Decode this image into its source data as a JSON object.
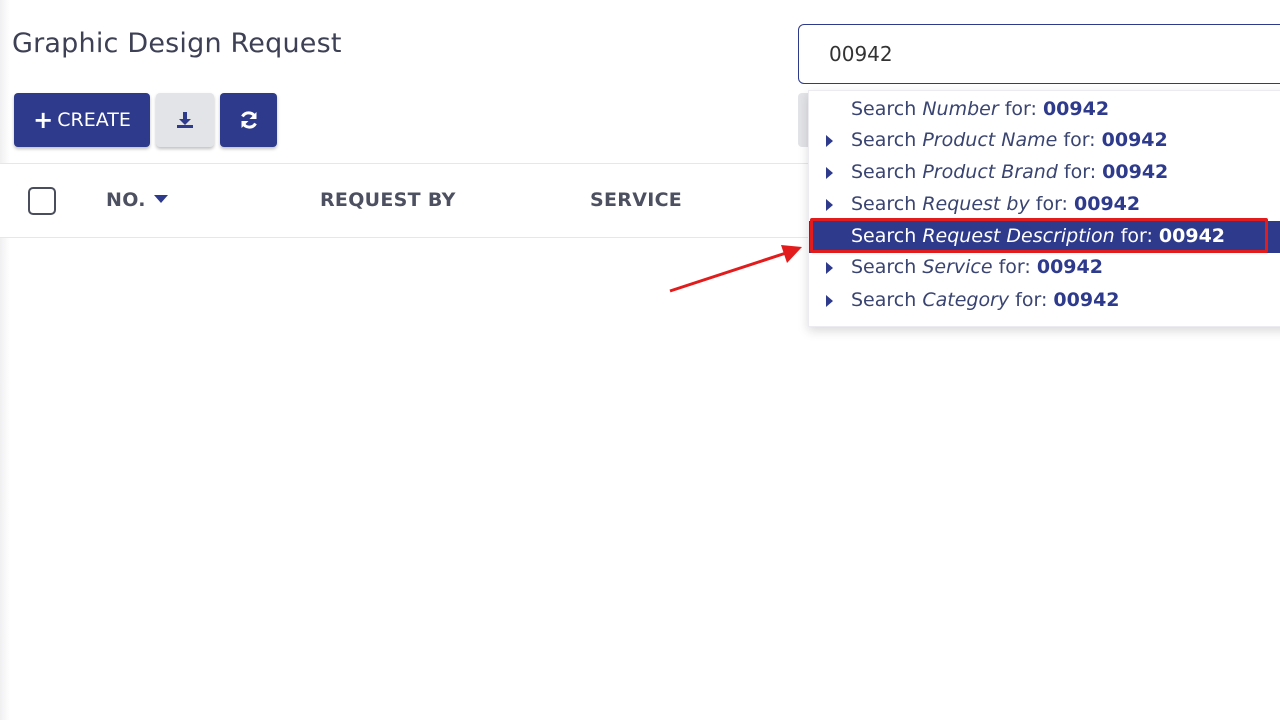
{
  "page": {
    "title": "Graphic Design Request"
  },
  "toolbar": {
    "create_label": "CREATE",
    "create_icon": "plus-icon",
    "download_icon": "download-icon",
    "refresh_icon": "refresh-icon"
  },
  "table": {
    "columns": [
      "NO.",
      "REQUEST BY",
      "SERVICE"
    ],
    "sort_column": "NO."
  },
  "search": {
    "value": "00942",
    "suggestions": [
      {
        "prefix": "Search",
        "field": "Number",
        "mid": "for:",
        "term": "00942",
        "expandable": false,
        "active": false
      },
      {
        "prefix": "Search",
        "field": "Product Name",
        "mid": "for:",
        "term": "00942",
        "expandable": true,
        "active": false
      },
      {
        "prefix": "Search",
        "field": "Product Brand",
        "mid": "for:",
        "term": "00942",
        "expandable": true,
        "active": false
      },
      {
        "prefix": "Search",
        "field": "Request by",
        "mid": "for:",
        "term": "00942",
        "expandable": true,
        "active": false
      },
      {
        "prefix": "Search",
        "field": "Request Description",
        "mid": "for:",
        "term": "00942",
        "expandable": false,
        "active": true
      },
      {
        "prefix": "Search",
        "field": "Service",
        "mid": "for:",
        "term": "00942",
        "expandable": true,
        "active": false
      },
      {
        "prefix": "Search",
        "field": "Category",
        "mid": "for:",
        "term": "00942",
        "expandable": true,
        "active": false
      }
    ]
  },
  "colors": {
    "primary": "#2e3a8c",
    "annotation": "#e21c1c",
    "secondary_button": "#e3e4e8"
  }
}
